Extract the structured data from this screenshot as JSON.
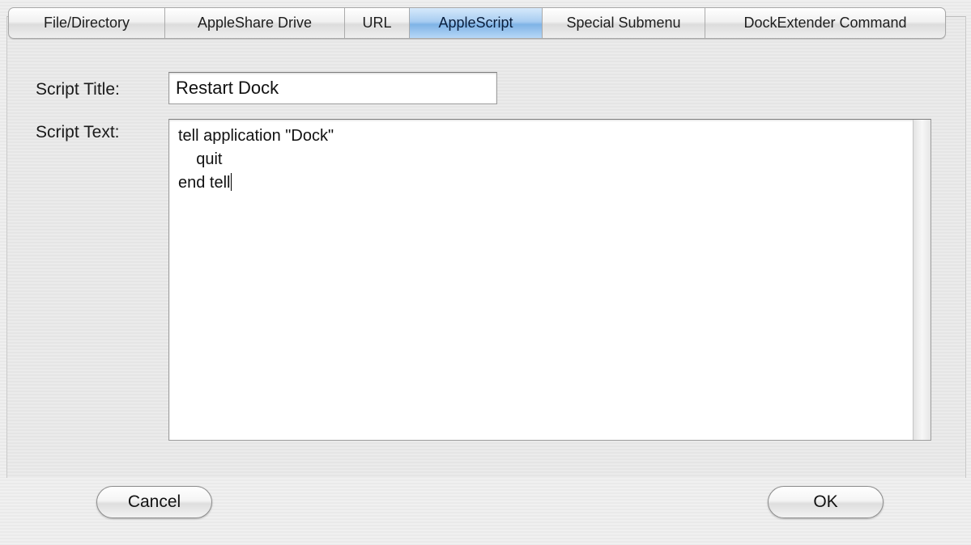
{
  "tabs": [
    {
      "label": "File/Directory"
    },
    {
      "label": "AppleShare Drive"
    },
    {
      "label": "URL"
    },
    {
      "label": "AppleScript",
      "active": true
    },
    {
      "label": "Special Submenu"
    },
    {
      "label": "DockExtender Command"
    }
  ],
  "form": {
    "title_label": "Script Title:",
    "title_value": "Restart Dock",
    "text_label": "Script Text:",
    "script_text": "tell application \"Dock\"\n    quit\nend tell"
  },
  "buttons": {
    "cancel": "Cancel",
    "ok": "OK"
  },
  "colors": {
    "active_tab": "#a8cdf1",
    "background": "#ececec"
  }
}
